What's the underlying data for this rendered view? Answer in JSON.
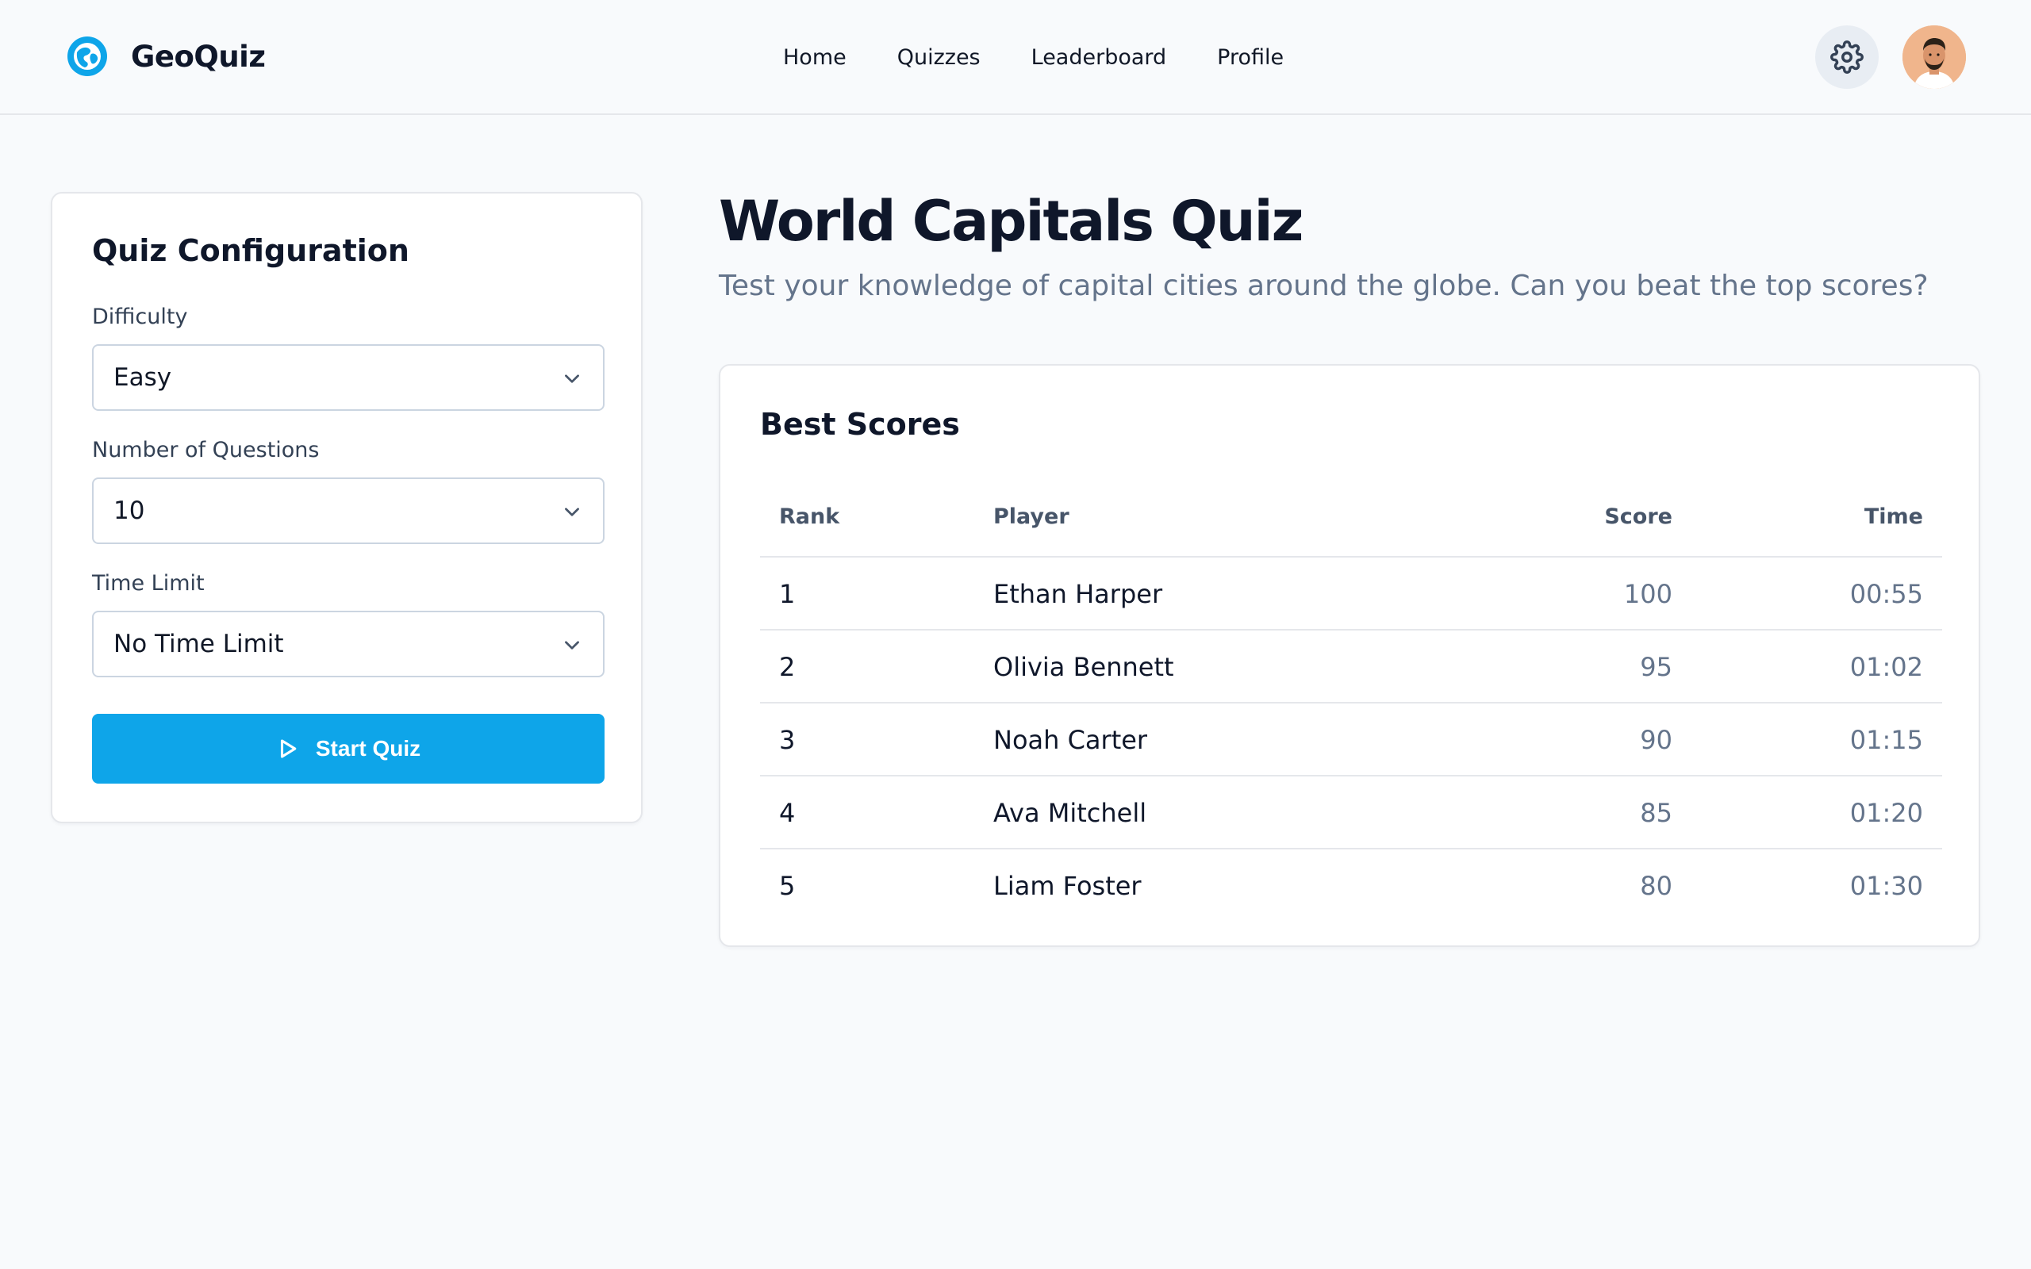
{
  "app": {
    "name": "GeoQuiz",
    "logo_icon": "globe-icon",
    "accent": "#0ea5e9"
  },
  "nav": {
    "items": [
      "Home",
      "Quizzes",
      "Leaderboard",
      "Profile"
    ]
  },
  "header": {
    "settings_icon": "gear-icon",
    "avatar_icon": "user-avatar"
  },
  "config": {
    "title": "Quiz Configuration",
    "difficulty": {
      "label": "Difficulty",
      "value": "Easy"
    },
    "questions": {
      "label": "Number of Questions",
      "value": "10"
    },
    "time_limit": {
      "label": "Time Limit",
      "value": "No Time Limit"
    },
    "start_button": {
      "label": "Start Quiz",
      "icon": "play-icon"
    }
  },
  "main": {
    "title": "World Capitals Quiz",
    "subtitle": "Test your knowledge of capital cities around the globe. Can you beat the top scores?"
  },
  "scores": {
    "title": "Best Scores",
    "columns": [
      "Rank",
      "Player",
      "Score",
      "Time"
    ],
    "rows": [
      {
        "rank": "1",
        "player": "Ethan Harper",
        "score": "100",
        "time": "00:55"
      },
      {
        "rank": "2",
        "player": "Olivia Bennett",
        "score": "95",
        "time": "01:02"
      },
      {
        "rank": "3",
        "player": "Noah Carter",
        "score": "90",
        "time": "01:15"
      },
      {
        "rank": "4",
        "player": "Ava Mitchell",
        "score": "85",
        "time": "01:20"
      },
      {
        "rank": "5",
        "player": "Liam Foster",
        "score": "80",
        "time": "01:30"
      }
    ]
  }
}
